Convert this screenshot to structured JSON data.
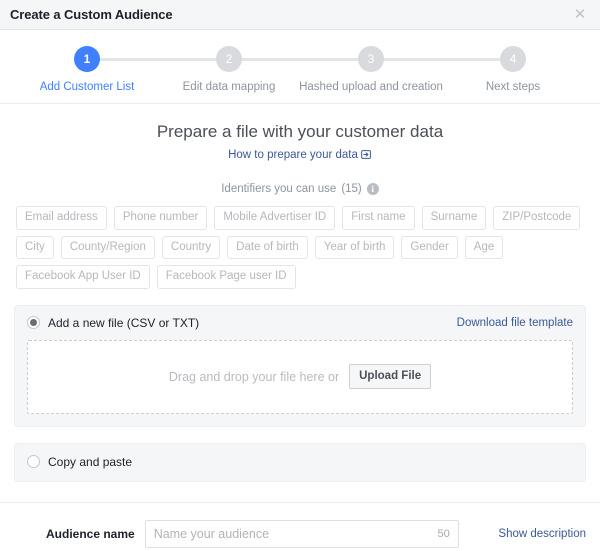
{
  "dialog": {
    "title": "Create a Custom Audience",
    "close_icon": "close-icon",
    "close_glyph": "✕"
  },
  "stepper": {
    "steps": [
      {
        "number": "1",
        "label": "Add Customer List",
        "active": true
      },
      {
        "number": "2",
        "label": "Edit data mapping",
        "active": false
      },
      {
        "number": "3",
        "label": "Hashed upload and creation",
        "active": false
      },
      {
        "number": "4",
        "label": "Next steps",
        "active": false
      }
    ],
    "active_color": "#4080ff",
    "inactive_color": "#d8dade"
  },
  "main": {
    "headline": "Prepare a file with your customer data",
    "help_link": "How to prepare your data",
    "identifiers_label": "Identifiers you can use",
    "identifiers_count": "(15)",
    "info_glyph": "i",
    "identifier_chips": [
      "Email address",
      "Phone number",
      "Mobile Advertiser ID",
      "First name",
      "Surname",
      "ZIP/Postcode",
      "City",
      "County/Region",
      "Country",
      "Date of birth",
      "Year of birth",
      "Gender",
      "Age",
      "Facebook App User ID",
      "Facebook Page user ID"
    ]
  },
  "add_file_panel": {
    "option_label": "Add a new file (CSV or TXT)",
    "selected": true,
    "download_template_link": "Download file template",
    "dropzone_text": "Drag and drop your file here or",
    "upload_button": "Upload File"
  },
  "copy_paste_panel": {
    "option_label": "Copy and paste",
    "selected": false
  },
  "footer": {
    "audience_name_label": "Audience name",
    "audience_name_value": "",
    "audience_name_placeholder": "Name your audience",
    "char_counter": "50",
    "show_description_link": "Show description"
  }
}
